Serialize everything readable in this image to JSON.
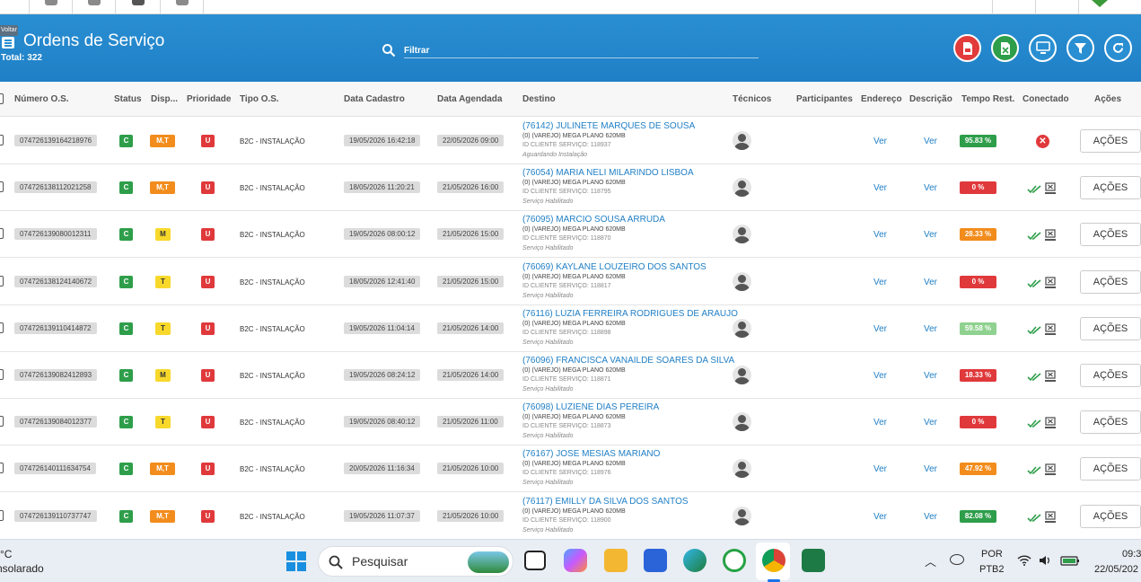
{
  "header": {
    "back_label": "Voltar",
    "title": "Ordens de Serviço",
    "total": "Total: 322",
    "search_placeholder": "Filtrar"
  },
  "columns": {
    "numero": "Número O.S.",
    "status": "Status",
    "disp": "Disp...",
    "prioridade": "Prioridade",
    "tipo": "Tipo O.S.",
    "cadastro": "Data Cadastro",
    "agendada": "Data Agendada",
    "destino": "Destino",
    "tecnicos": "Técnicos",
    "participantes": "Participantes",
    "endereco": "Endereço",
    "descricao": "Descrição",
    "tempo": "Tempo Rest.",
    "conectado": "Conectado",
    "acoes": "Ações"
  },
  "rows": [
    {
      "numero": "074726139164218976",
      "status": "C",
      "disp": "M,T",
      "disp_color": "orange",
      "prioridade": "U",
      "tipo": "B2C - INSTALAÇÃO",
      "cadastro": "19/05/2026 16:42:18",
      "agendada": "22/05/2026 09:00",
      "dest_name": "(76142) JULINETE MARQUES DE SOUSA",
      "dest_plan": "(0) (VAREJO) MEGA PLANO 620MB",
      "dest_id": "ID CLIENTE SERVIÇO: 118937",
      "dest_status": "Aguardando Instalação",
      "endereco": "Ver",
      "descricao": "Ver",
      "tempo": "95.83 %",
      "tempo_color": "#2e9e4a",
      "conectado": "no",
      "acoes": "AÇÕES"
    },
    {
      "numero": "074726138112021258",
      "status": "C",
      "disp": "M,T",
      "disp_color": "orange",
      "prioridade": "U",
      "tipo": "B2C - INSTALAÇÃO",
      "cadastro": "18/05/2026 11:20:21",
      "agendada": "21/05/2026 16:00",
      "dest_name": "(76054) MARIA NELI MILARINDO LISBOA",
      "dest_plan": "(0) (VAREJO) MEGA PLANO 620MB",
      "dest_id": "ID CLIENTE SERVIÇO: 118795",
      "dest_status": "Serviço Habilitado",
      "endereco": "Ver",
      "descricao": "Ver",
      "tempo": "0 %",
      "tempo_color": "#e0393b",
      "conectado": "yes",
      "acoes": "AÇÕES"
    },
    {
      "numero": "074726139080012311",
      "status": "C",
      "disp": "M",
      "disp_color": "yellow",
      "prioridade": "U",
      "tipo": "B2C - INSTALAÇÃO",
      "cadastro": "19/05/2026 08:00:12",
      "agendada": "21/05/2026 15:00",
      "dest_name": "(76095) MARCIO SOUSA ARRUDA",
      "dest_plan": "(0) (VAREJO) MEGA PLANO 620MB",
      "dest_id": "ID CLIENTE SERVIÇO: 118870",
      "dest_status": "Serviço Habilitado",
      "endereco": "Ver",
      "descricao": "Ver",
      "tempo": "28.33 %",
      "tempo_color": "#f28c1c",
      "conectado": "yes",
      "acoes": "AÇÕES"
    },
    {
      "numero": "074726138124140672",
      "status": "C",
      "disp": "T",
      "disp_color": "yellow",
      "prioridade": "U",
      "tipo": "B2C - INSTALAÇÃO",
      "cadastro": "18/05/2026 12:41:40",
      "agendada": "21/05/2026 15:00",
      "dest_name": "(76069) KAYLANE LOUZEIRO DOS SANTOS",
      "dest_plan": "(0) (VAREJO) MEGA PLANO 620MB",
      "dest_id": "ID CLIENTE SERVIÇO: 118817",
      "dest_status": "Serviço Habilitado",
      "endereco": "Ver",
      "descricao": "Ver",
      "tempo": "0 %",
      "tempo_color": "#e0393b",
      "conectado": "yes",
      "acoes": "AÇÕES"
    },
    {
      "numero": "074726139110414872",
      "status": "C",
      "disp": "T",
      "disp_color": "yellow",
      "prioridade": "U",
      "tipo": "B2C - INSTALAÇÃO",
      "cadastro": "19/05/2026 11:04:14",
      "agendada": "21/05/2026 14:00",
      "dest_name": "(76116) LUZIA FERREIRA RODRIGUES DE ARAUJO",
      "dest_plan": "(0) (VAREJO) MEGA PLANO 620MB",
      "dest_id": "ID CLIENTE SERVIÇO: 118898",
      "dest_status": "Serviço Habilitado",
      "endereco": "Ver",
      "descricao": "Ver",
      "tempo": "59.58 %",
      "tempo_color": "#8fd18f",
      "conectado": "yes",
      "acoes": "AÇÕES"
    },
    {
      "numero": "074726139082412893",
      "status": "C",
      "disp": "M",
      "disp_color": "yellow",
      "prioridade": "U",
      "tipo": "B2C - INSTALAÇÃO",
      "cadastro": "19/05/2026 08:24:12",
      "agendada": "21/05/2026 14:00",
      "dest_name": "(76096) FRANCISCA VANAILDE SOARES DA SILVA",
      "dest_plan": "(0) (VAREJO) MEGA PLANO 620MB",
      "dest_id": "ID CLIENTE SERVIÇO: 118871",
      "dest_status": "Serviço Habilitado",
      "endereco": "Ver",
      "descricao": "Ver",
      "tempo": "18.33 %",
      "tempo_color": "#e0393b",
      "conectado": "yes",
      "acoes": "AÇÕES"
    },
    {
      "numero": "074726139084012377",
      "status": "C",
      "disp": "T",
      "disp_color": "yellow",
      "prioridade": "U",
      "tipo": "B2C - INSTALAÇÃO",
      "cadastro": "19/05/2026 08:40:12",
      "agendada": "21/05/2026 11:00",
      "dest_name": "(76098) LUZIENE DIAS PEREIRA",
      "dest_plan": "(0) (VAREJO) MEGA PLANO 620MB",
      "dest_id": "ID CLIENTE SERVIÇO: 118873",
      "dest_status": "Serviço Habilitado",
      "endereco": "Ver",
      "descricao": "Ver",
      "tempo": "0 %",
      "tempo_color": "#e0393b",
      "conectado": "yes",
      "acoes": "AÇÕES"
    },
    {
      "numero": "074726140111634754",
      "status": "C",
      "disp": "M,T",
      "disp_color": "orange",
      "prioridade": "U",
      "tipo": "B2C - INSTALAÇÃO",
      "cadastro": "20/05/2026 11:16:34",
      "agendada": "21/05/2026 10:00",
      "dest_name": "(76167) JOSE MESIAS MARIANO",
      "dest_plan": "(0) (VAREJO) MEGA PLANO 620MB",
      "dest_id": "ID CLIENTE SERVIÇO: 118976",
      "dest_status": "Serviço Habilitado",
      "endereco": "Ver",
      "descricao": "Ver",
      "tempo": "47.92 %",
      "tempo_color": "#f28c1c",
      "conectado": "yes",
      "acoes": "AÇÕES"
    },
    {
      "numero": "074726139110737747",
      "status": "C",
      "disp": "M,T",
      "disp_color": "orange",
      "prioridade": "U",
      "tipo": "B2C - INSTALAÇÃO",
      "cadastro": "19/05/2026 11:07:37",
      "agendada": "21/05/2026 10:00",
      "dest_name": "(76117) EMILLY DA SILVA DOS SANTOS",
      "dest_plan": "(0) (VAREJO) MEGA PLANO 620MB",
      "dest_id": "ID CLIENTE SERVIÇO: 118900",
      "dest_status": "Serviço Habilitado",
      "endereco": "Ver",
      "descricao": "Ver",
      "tempo": "82.08 %",
      "tempo_color": "#2e9e4a",
      "conectado": "yes",
      "acoes": "AÇÕES"
    }
  ],
  "taskbar": {
    "weather_temp": "°C",
    "weather_desc": "Ensolarado",
    "search_label": "Pesquisar",
    "lang": "POR",
    "layout": "PTB2",
    "time": "09:3",
    "date": "22/05/202"
  }
}
